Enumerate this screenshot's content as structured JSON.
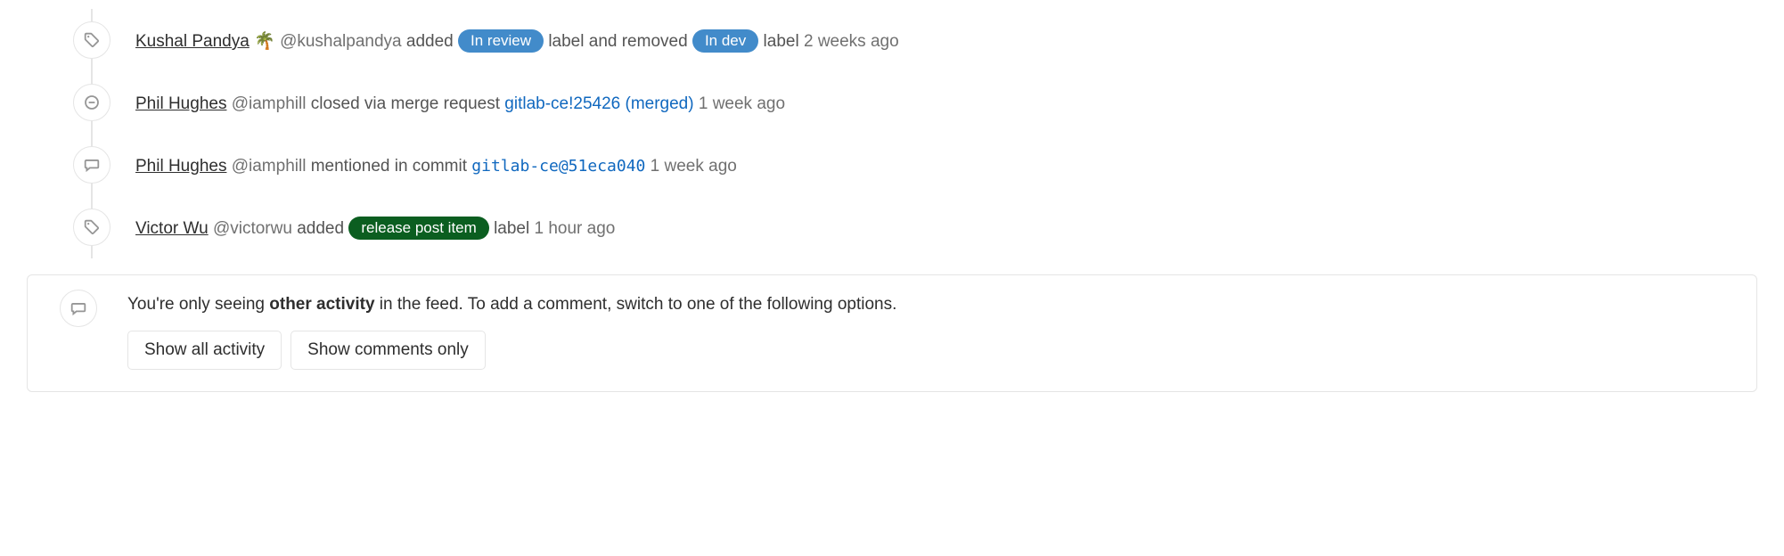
{
  "events": [
    {
      "icon": "label",
      "author_name": "Kushal Pandya",
      "author_emoji": "🌴",
      "username": "@kushalpandya",
      "action_before_label1": "added",
      "label1_text": "In review",
      "label1_color": "blue",
      "middle_text": "label and removed",
      "label2_text": "In dev",
      "label2_color": "blue",
      "after_text": "label",
      "time": "2 weeks ago"
    },
    {
      "icon": "closed",
      "author_name": "Phil Hughes",
      "username": "@iamphill",
      "action_text": "closed via merge request",
      "link_text": "gitlab-ce!25426 (merged)",
      "time": "1 week ago"
    },
    {
      "icon": "comment",
      "author_name": "Phil Hughes",
      "username": "@iamphill",
      "action_text": "mentioned in commit",
      "link_text": "gitlab-ce@51eca040",
      "link_mono": true,
      "time": "1 week ago"
    },
    {
      "icon": "label",
      "author_name": "Victor Wu",
      "username": "@victorwu",
      "action_before_label1": "added",
      "label1_text": "release post item",
      "label1_color": "green",
      "after_text": "label",
      "time": "1 hour ago"
    }
  ],
  "filter": {
    "prefix": "You're only seeing ",
    "bold": "other activity",
    "suffix": " in the feed. To add a comment, switch to one of the following options.",
    "btn_all": "Show all activity",
    "btn_comments": "Show comments only"
  }
}
